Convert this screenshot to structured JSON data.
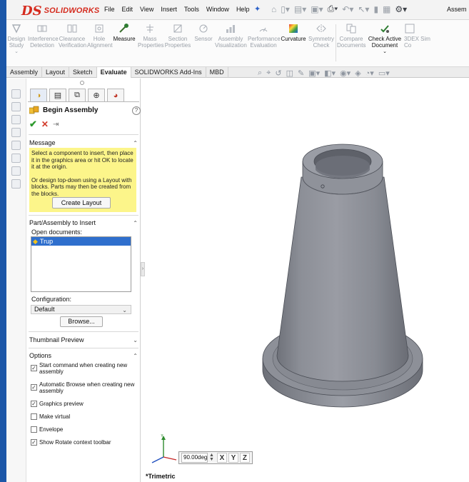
{
  "app": {
    "logo_ds": "DS",
    "logo_text": "SOLIDWORKS",
    "window_title_partial": "Assem"
  },
  "menus": [
    "File",
    "Edit",
    "View",
    "Insert",
    "Tools",
    "Window",
    "Help"
  ],
  "ribbon": {
    "tools": [
      {
        "label": "Design Study",
        "active": false
      },
      {
        "label": "Interference Detection",
        "active": false
      },
      {
        "label": "Clearance Verification",
        "active": false
      },
      {
        "label": "Hole Alignment",
        "active": false
      },
      {
        "label": "Measure",
        "active": true
      },
      {
        "label": "Mass Properties",
        "active": false
      },
      {
        "label": "Section Properties",
        "active": false
      },
      {
        "label": "Sensor",
        "active": false
      },
      {
        "label": "Assembly Visualization",
        "active": false
      },
      {
        "label": "Performance Evaluation",
        "active": false
      },
      {
        "label": "Curvature",
        "active": true
      },
      {
        "label": "Symmetry Check",
        "active": false
      },
      {
        "label": "Compare Documents",
        "active": false
      },
      {
        "label": "Check Active Document",
        "active": true
      },
      {
        "label": "3DEX Sim Co",
        "active": false
      }
    ]
  },
  "tabs": [
    "Assembly",
    "Layout",
    "Sketch",
    "Evaluate",
    "SOLIDWORKS Add-Ins",
    "MBD"
  ],
  "active_tab": "Evaluate",
  "property_manager": {
    "title": "Begin Assembly",
    "help": "?",
    "ok": "✔",
    "cancel": "✕",
    "pin": "⇥",
    "message_header": "Message",
    "message_p1": "Select a component to insert, then place it in the graphics area or hit OK to locate it at the origin.",
    "message_p2": "Or design top-down using a Layout with blocks. Parts may then be created from the blocks.",
    "create_layout": "Create Layout",
    "part_header": "Part/Assembly to Insert",
    "open_documents_label": "Open documents:",
    "open_documents": [
      "Trup"
    ],
    "configuration_label": "Configuration:",
    "configuration_value": "Default",
    "browse": "Browse...",
    "thumbnail_header": "Thumbnail Preview",
    "options_header": "Options",
    "options": [
      {
        "label": "Start command when creating new assembly",
        "checked": true
      },
      {
        "label": "Automatic Browse when creating new assembly",
        "checked": true
      },
      {
        "label": "Graphics preview",
        "checked": true
      },
      {
        "label": "Make virtual",
        "checked": false
      },
      {
        "label": "Envelope",
        "checked": false
      },
      {
        "label": "Show Rotate context toolbar",
        "checked": true
      }
    ]
  },
  "graphics": {
    "rotate_value": "90.00deg",
    "axis_buttons": [
      "X",
      "Y",
      "Z"
    ],
    "view_label": "*Trimetric",
    "model_color": "#8e9098"
  }
}
